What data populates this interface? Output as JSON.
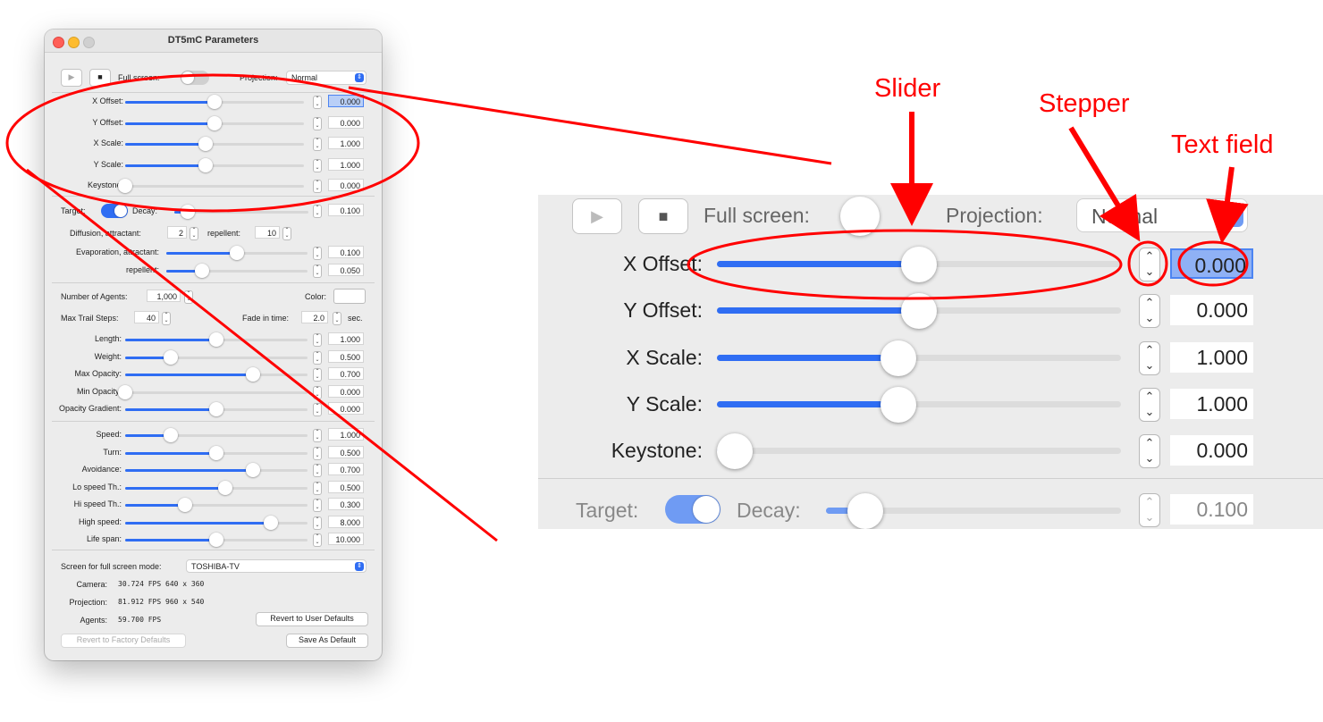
{
  "window": {
    "title": "DT5mC Parameters"
  },
  "top": {
    "full_screen_label": "Full screen:",
    "projection_label": "Projection:",
    "projection_value": "Normal"
  },
  "transform": [
    {
      "label": "X Offset:",
      "value": "0.000",
      "level": 0.5
    },
    {
      "label": "Y Offset:",
      "value": "0.000",
      "level": 0.5
    },
    {
      "label": "X Scale:",
      "value": "1.000",
      "level": 0.45
    },
    {
      "label": "Y Scale:",
      "value": "1.000",
      "level": 0.45
    },
    {
      "label": "Keystone:",
      "value": "0.000",
      "level": 0.0
    }
  ],
  "target": {
    "label": "Target:",
    "decay_label": "Decay:",
    "decay_value": "0.100",
    "decay_level": 0.1
  },
  "diffusion": {
    "label": "Diffusion, attractant:",
    "attractant": "2",
    "repellent_label": "repellent:",
    "repellent": "10"
  },
  "evaporation": [
    {
      "label": "Evaporation, attractant:",
      "value": "0.100",
      "level": 0.5
    },
    {
      "label": "repellent:",
      "value": "0.050",
      "level": 0.25
    }
  ],
  "agents_section": {
    "count_label": "Number of Agents:",
    "count": "1,000",
    "color_label": "Color:",
    "trail_label": "Max Trail Steps:",
    "trail": "40",
    "fade_label": "Fade in time:",
    "fade": "2.0",
    "fade_unit": "sec."
  },
  "trail_sliders": [
    {
      "label": "Length:",
      "value": "1.000",
      "level": 0.5
    },
    {
      "label": "Weight:",
      "value": "0.500",
      "level": 0.25
    },
    {
      "label": "Max Opacity:",
      "value": "0.700",
      "level": 0.7
    },
    {
      "label": "Min Opacity:",
      "value": "0.000",
      "level": 0.0
    },
    {
      "label": "Opacity Gradient:",
      "value": "0.000",
      "level": 0.5
    }
  ],
  "motion_sliders": [
    {
      "label": "Speed:",
      "value": "1.000",
      "level": 0.25
    },
    {
      "label": "Turn:",
      "value": "0.500",
      "level": 0.5
    },
    {
      "label": "Avoidance:",
      "value": "0.700",
      "level": 0.7
    },
    {
      "label": "Lo speed Th.:",
      "value": "0.500",
      "level": 0.55
    },
    {
      "label": "Hi speed Th.:",
      "value": "0.300",
      "level": 0.33
    },
    {
      "label": "High speed:",
      "value": "8.000",
      "level": 0.8
    },
    {
      "label": "Life span:",
      "value": "10.000",
      "level": 0.5
    }
  ],
  "footer": {
    "screen_label": "Screen for full screen mode:",
    "screen_value": "TOSHIBA-TV",
    "camera_label": "Camera:",
    "camera_fps": "30.724",
    "camera_size": "640 x 360",
    "projection_label": "Projection:",
    "projection_fps": "81.912",
    "projection_size": "960 x 540",
    "agents_label": "Agents:",
    "agents_fps": "59.700",
    "fps_unit": "FPS",
    "revert_user": "Revert to User Defaults",
    "revert_factory": "Revert to Factory Defaults",
    "save_default": "Save As Default"
  },
  "zoom": {
    "full_screen_label": "Full screen:",
    "projection_label": "Projection:",
    "projection_value": "Normal",
    "rows": [
      {
        "label": "X Offset:",
        "value": "0.000",
        "level": 0.5
      },
      {
        "label": "Y Offset:",
        "value": "0.000",
        "level": 0.5
      },
      {
        "label": "X Scale:",
        "value": "1.000",
        "level": 0.45
      },
      {
        "label": "Y Scale:",
        "value": "1.000",
        "level": 0.45
      },
      {
        "label": "Keystone:",
        "value": "0.000",
        "level": 0.0
      }
    ],
    "target_label": "Target:",
    "decay_label": "Decay:",
    "decay_value": "0.100"
  },
  "annotations": {
    "slider": "Slider",
    "stepper": "Stepper",
    "text_field": "Text field"
  },
  "colors": {
    "accent": "#2f6df3",
    "annotation": "#ff0000"
  }
}
